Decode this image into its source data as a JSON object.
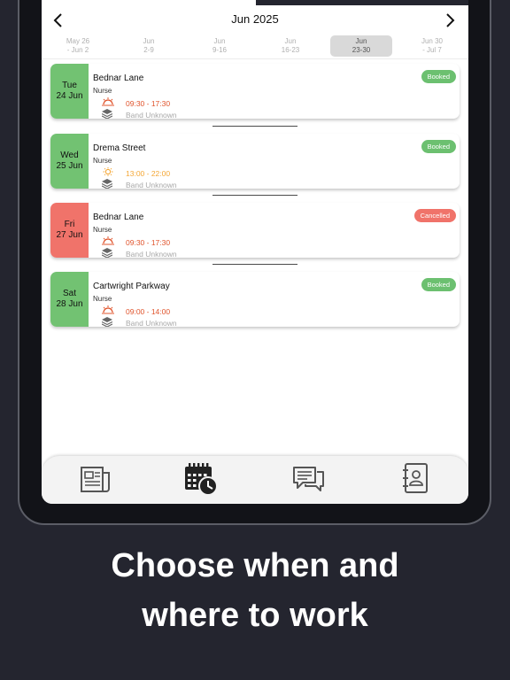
{
  "calendar": {
    "month_title": "Jun 2025",
    "prev_icon": "chevron-left-icon",
    "next_icon": "chevron-right-icon",
    "weeks": [
      {
        "line1": "May 26",
        "line2": "- Jun 2",
        "active": false
      },
      {
        "line1": "Jun",
        "line2": "2-9",
        "active": false
      },
      {
        "line1": "Jun",
        "line2": "9-16",
        "active": false
      },
      {
        "line1": "Jun",
        "line2": "16-23",
        "active": false
      },
      {
        "line1": "Jun",
        "line2": "23-30",
        "active": true
      },
      {
        "line1": "Jun 30",
        "line2": "- Jul 7",
        "active": false
      }
    ]
  },
  "shifts": [
    {
      "day": "Tue",
      "date": "24 Jun",
      "location": "Bednar Lane",
      "role": "Nurse",
      "time": "09:30 - 17:30",
      "band": "Band Unknown",
      "status": "Booked",
      "status_color": "#6cc070",
      "date_color": "#72c272",
      "time_color": "#e0542c",
      "time_icon": "sunrise-icon"
    },
    {
      "day": "Wed",
      "date": "25 Jun",
      "location": "Drema Street",
      "role": "Nurse",
      "time": "13:00 - 22:00",
      "band": "Band Unknown",
      "status": "Booked",
      "status_color": "#6cc070",
      "date_color": "#72c272",
      "time_color": "#f4a735",
      "time_icon": "sun-icon"
    },
    {
      "day": "Fri",
      "date": "27 Jun",
      "location": "Bednar Lane",
      "role": "Nurse",
      "time": "09:30 - 17:30",
      "band": "Band Unknown",
      "status": "Cancelled",
      "status_color": "#f0736a",
      "date_color": "#f0736a",
      "time_color": "#e0542c",
      "time_icon": "sunrise-icon"
    },
    {
      "day": "Sat",
      "date": "28 Jun",
      "location": "Cartwright Parkway",
      "role": "Nurse",
      "time": "09:00 - 14:00",
      "band": "Band Unknown",
      "status": "Booked",
      "status_color": "#6cc070",
      "date_color": "#72c272",
      "time_color": "#e0542c",
      "time_icon": "sunrise-icon"
    }
  ],
  "tabbar": {
    "tabs": [
      {
        "icon": "newspaper-icon",
        "active": false
      },
      {
        "icon": "calendar-clock-icon",
        "active": true
      },
      {
        "icon": "chat-bubbles-icon",
        "active": false
      },
      {
        "icon": "contacts-book-icon",
        "active": false
      }
    ]
  },
  "promo": {
    "line1": "Choose when and",
    "line2": "where to work"
  }
}
